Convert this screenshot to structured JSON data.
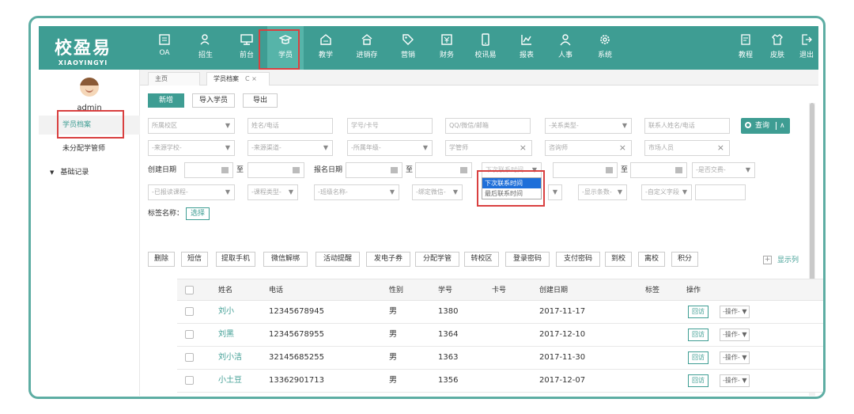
{
  "logo": {
    "cn": "校盈易",
    "en": "XIAOYINGYI"
  },
  "nav": [
    {
      "label": "OA",
      "icon": "oa-icon"
    },
    {
      "label": "招生",
      "icon": "recruit-icon"
    },
    {
      "label": "前台",
      "icon": "monitor-icon"
    },
    {
      "label": "学员",
      "icon": "graduation-cap-icon"
    },
    {
      "label": "教学",
      "icon": "teaching-icon"
    },
    {
      "label": "进销存",
      "icon": "inventory-icon"
    },
    {
      "label": "营销",
      "icon": "tag-icon"
    },
    {
      "label": "财务",
      "icon": "finance-icon"
    },
    {
      "label": "校讯易",
      "icon": "phone-icon"
    },
    {
      "label": "报表",
      "icon": "chart-icon"
    },
    {
      "label": "人事",
      "icon": "person-icon"
    },
    {
      "label": "系统",
      "icon": "gear-icon"
    }
  ],
  "nav_right": [
    {
      "label": "教程",
      "icon": "tutorial-icon"
    },
    {
      "label": "皮肤",
      "icon": "skin-icon"
    },
    {
      "label": "退出",
      "icon": "logout-icon"
    }
  ],
  "sidebar": {
    "user": "admin",
    "items": [
      {
        "label": "学员档案"
      },
      {
        "label": "未分配学管师"
      },
      {
        "label": "基础记录"
      }
    ]
  },
  "tabs": [
    {
      "label": "主页"
    },
    {
      "label": "学员档案"
    }
  ],
  "tab_close": "C ×",
  "toolbar": {
    "add": "新增",
    "import": "导入学员",
    "export": "导出"
  },
  "filters": {
    "school": "所属校区",
    "name_phone": "姓名/电话",
    "student_card": "学号/卡号",
    "qq_wechat": "QQ/微信/邮箱",
    "relation_type": "-关系类型-",
    "contact": "联系人姓名/电话",
    "search": "查询",
    "source_school": "-来源学校-",
    "source_channel": "-来源渠道-",
    "grade": "-所属年级-",
    "manager": "学管师",
    "consultant": "咨询师",
    "market": "市场人员",
    "create_date": "创建日期",
    "to": "至",
    "signup_date": "报名日期",
    "contact_time": "下次联系时间",
    "paid": "-是否交费-",
    "course": "-已报读课程-",
    "course_type": "-课程类型-",
    "class_name": "-班级名称-",
    "wechat_bind": "-绑定微信-",
    "show_count": "-显示条数-",
    "custom_field": "-自定义字段",
    "tag_label": "标签名称：",
    "select": "选择"
  },
  "dropdown": [
    {
      "label": "下次联系时间"
    },
    {
      "label": "最后联系时间"
    }
  ],
  "actions": [
    {
      "label": "删除"
    },
    {
      "label": "短信"
    },
    {
      "label": "提取手机"
    },
    {
      "label": "微信解绑"
    },
    {
      "label": "活动提醒"
    },
    {
      "label": "发电子券"
    },
    {
      "label": "分配学管"
    },
    {
      "label": "转校区"
    },
    {
      "label": "登录密码"
    },
    {
      "label": "支付密码"
    },
    {
      "label": "到校"
    },
    {
      "label": "离校"
    },
    {
      "label": "积分"
    }
  ],
  "show_columns": "显示列",
  "table": {
    "headers": [
      "姓名",
      "电话",
      "性别",
      "学号",
      "卡号",
      "创建日期",
      "标签",
      "操作"
    ],
    "rows": [
      {
        "name": "刘小",
        "phone": "12345678945",
        "gender": "男",
        "id": "1380",
        "date": "2017-11-17"
      },
      {
        "name": "刘黑",
        "phone": "12345678955",
        "gender": "男",
        "id": "1364",
        "date": "2017-12-10"
      },
      {
        "name": "刘小洁",
        "phone": "32145685255",
        "gender": "男",
        "id": "1363",
        "date": "2017-11-30"
      },
      {
        "name": "小土豆",
        "phone": "13362901713",
        "gender": "男",
        "id": "1356",
        "date": "2017-12-07"
      }
    ],
    "visit": "回访",
    "op": "-操作-"
  },
  "colors": {
    "brand": "#3e9d93",
    "highlight": "#d94040"
  }
}
